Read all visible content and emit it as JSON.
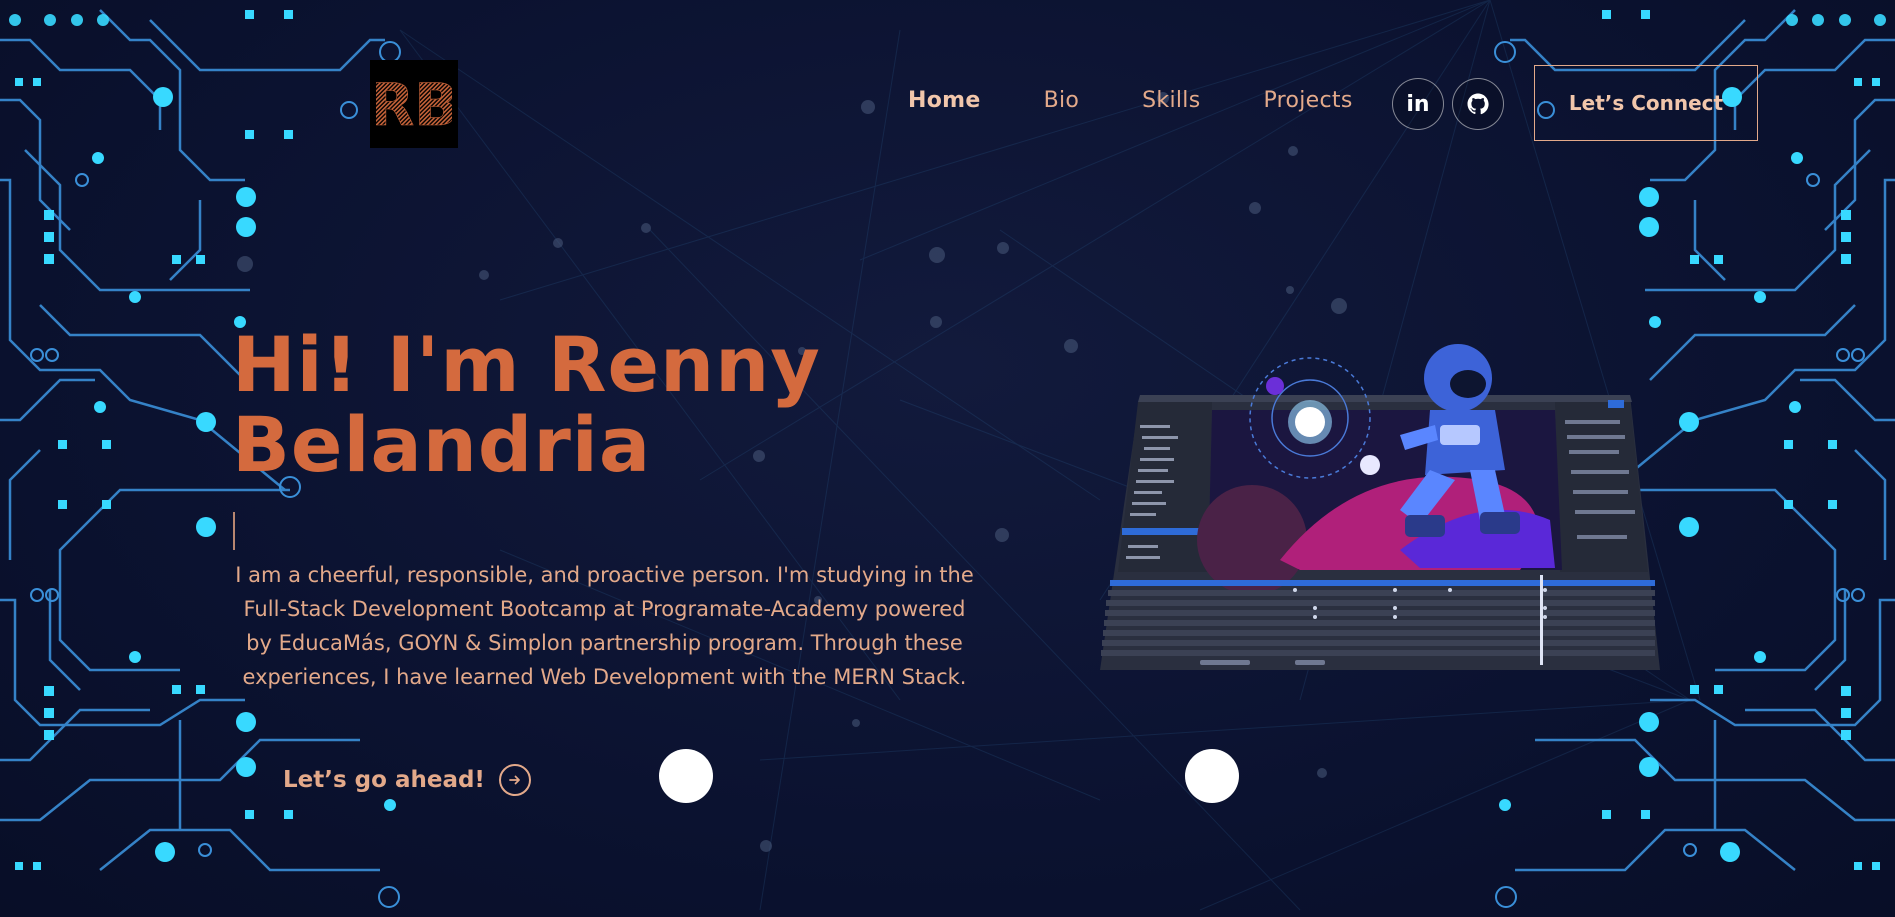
{
  "header": {
    "logo_text": "RB",
    "nav": [
      {
        "label": "Home",
        "active": true
      },
      {
        "label": "Bio",
        "active": false
      },
      {
        "label": "Skills",
        "active": false
      },
      {
        "label": "Projects",
        "active": false
      }
    ],
    "social": [
      {
        "icon": "linkedin-icon",
        "glyph": "in"
      },
      {
        "icon": "github-icon",
        "glyph": "github"
      }
    ],
    "connect_label": "Let’s Connect"
  },
  "hero": {
    "title_line1": "Hi! I'm Renny",
    "title_line2": "Belandria",
    "description": "I am a cheerful, responsible, and proactive person. I'm studying in the Full-Stack Development Bootcamp at Programate-Academy powered by EducaMás, GOYN & Simplon partnership program. Through these experiences, I have learned Web Development with the MERN Stack.",
    "cta_label": "Let’s go ahead!",
    "cta_icon": "arrow-right-circle-icon"
  },
  "illustration": {
    "icon": "astronaut-editor-illustration"
  },
  "colors": {
    "background": "#0b1230",
    "accent": "#d46a3e",
    "text": "#e3a98a",
    "circuit": "#3fa9f5",
    "circuit_glow": "#3fe0ff"
  }
}
